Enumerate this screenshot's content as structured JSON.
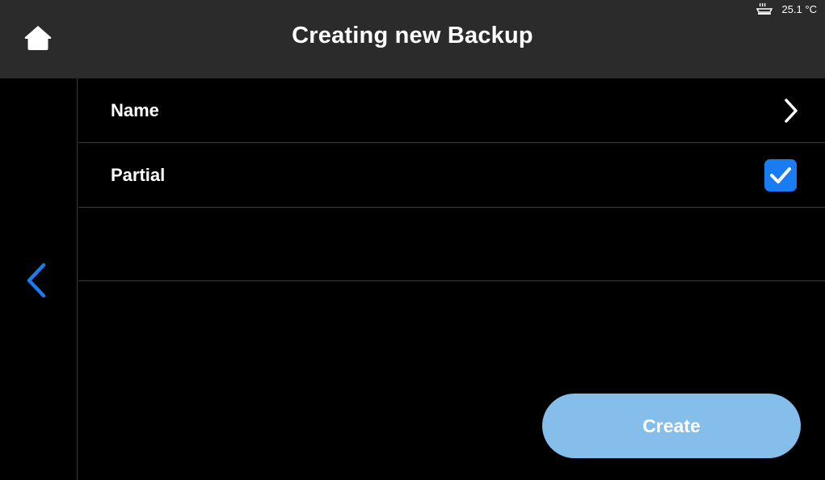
{
  "header": {
    "title": "Creating new Backup",
    "home_icon": "home-icon"
  },
  "status": {
    "temperature": "25.1 °C",
    "icon": "heatbed-icon"
  },
  "sidebar": {
    "back_icon": "chevron-left-icon"
  },
  "rows": [
    {
      "label": "Name",
      "control": "chevron-right-icon"
    },
    {
      "label": "Partial",
      "control": "checkbox",
      "checked": true
    }
  ],
  "actions": {
    "create_label": "Create"
  },
  "colors": {
    "header_bg": "#2b2b2b",
    "accent_blue": "#1a7cf2",
    "create_button_bg": "#85bdeb",
    "divider": "#3a3a3a"
  }
}
